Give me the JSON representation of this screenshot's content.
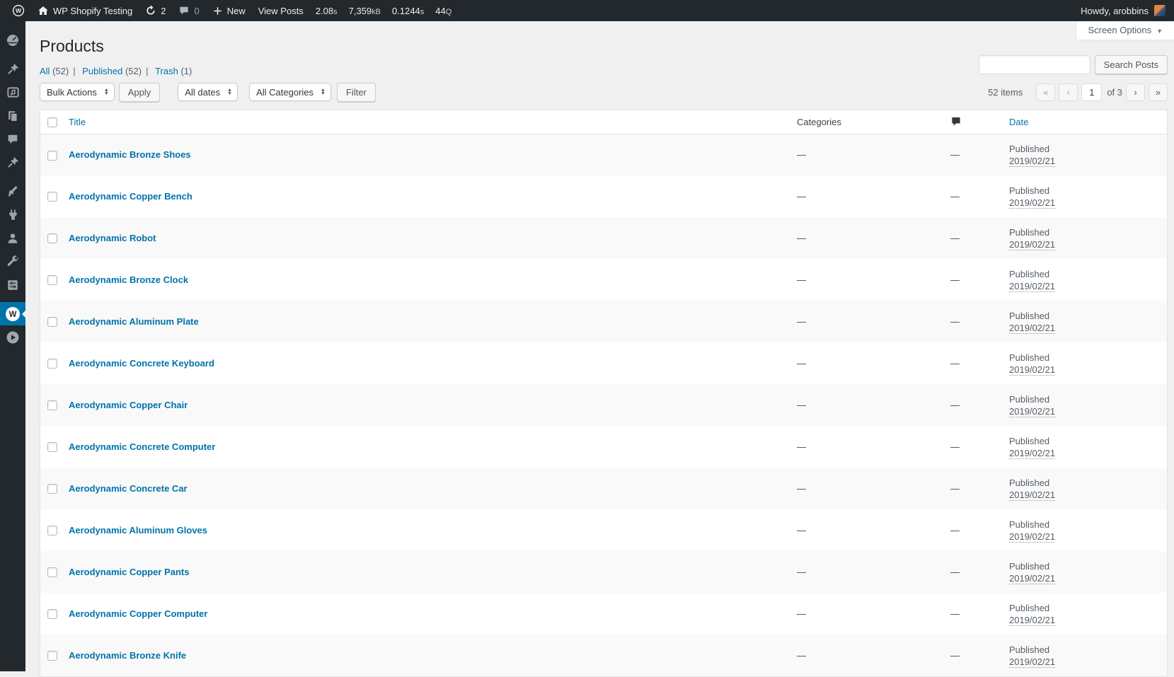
{
  "admin_bar": {
    "site_name": "WP Shopify Testing",
    "update_count": "2",
    "comment_count": "0",
    "new_label": "New",
    "view_posts_label": "View Posts",
    "stats": [
      {
        "v": "2.08",
        "u": "s"
      },
      {
        "v": "7,359",
        "u": "kB"
      },
      {
        "v": "0.1244",
        "u": "s"
      },
      {
        "v": "44",
        "u": "Q"
      }
    ],
    "howdy": "Howdy, arobbins",
    "bg_color": "#23282d"
  },
  "screen_options": {
    "label": "Screen Options",
    "caret": "▼"
  },
  "sidebar": {
    "active_item": "wp-shopify",
    "icons": [
      "dashboard-icon",
      "posts-pin-icon",
      "media-icon",
      "pages-icon",
      "comments-icon",
      "products-pin-icon",
      "appearance-brush-icon",
      "plugins-plug-icon",
      "users-icon",
      "tools-wrench-icon",
      "settings-icon",
      "wp-shopify-icon",
      "play-circle-icon"
    ],
    "active_color": "#0073aa"
  },
  "page": {
    "title": "Products",
    "filters": [
      {
        "label": "All",
        "count": "(52)"
      },
      {
        "label": "Published",
        "count": "(52)"
      },
      {
        "label": "Trash",
        "count": "(1)"
      }
    ],
    "filter_separator": "|",
    "search": {
      "value": "",
      "button_label": "Search Posts"
    },
    "toolbar": {
      "bulk_actions": "Bulk Actions",
      "apply": "Apply",
      "all_dates": "All dates",
      "all_categories": "All Categories",
      "filter": "Filter"
    },
    "pagination": {
      "items_count": "52 items",
      "first": "«",
      "prev": "‹",
      "current_page": "1",
      "of": "of 3",
      "next": "›",
      "last": "»"
    },
    "accent_color": "#0073aa"
  },
  "table": {
    "headers": {
      "title": "Title",
      "categories": "Categories",
      "comments_icon": "comment-bubble-icon",
      "date": "Date"
    },
    "rows": [
      {
        "title": "Aerodynamic Bronze Shoes",
        "categories": "—",
        "comments": "—",
        "status": "Published",
        "date": "2019/02/21"
      },
      {
        "title": "Aerodynamic Copper Bench",
        "categories": "—",
        "comments": "—",
        "status": "Published",
        "date": "2019/02/21"
      },
      {
        "title": "Aerodynamic Robot",
        "categories": "—",
        "comments": "—",
        "status": "Published",
        "date": "2019/02/21"
      },
      {
        "title": "Aerodynamic Bronze Clock",
        "categories": "—",
        "comments": "—",
        "status": "Published",
        "date": "2019/02/21"
      },
      {
        "title": "Aerodynamic Aluminum Plate",
        "categories": "—",
        "comments": "—",
        "status": "Published",
        "date": "2019/02/21"
      },
      {
        "title": "Aerodynamic Concrete Keyboard",
        "categories": "—",
        "comments": "—",
        "status": "Published",
        "date": "2019/02/21"
      },
      {
        "title": "Aerodynamic Copper Chair",
        "categories": "—",
        "comments": "—",
        "status": "Published",
        "date": "2019/02/21"
      },
      {
        "title": "Aerodynamic Concrete Computer",
        "categories": "—",
        "comments": "—",
        "status": "Published",
        "date": "2019/02/21"
      },
      {
        "title": "Aerodynamic Concrete Car",
        "categories": "—",
        "comments": "—",
        "status": "Published",
        "date": "2019/02/21"
      },
      {
        "title": "Aerodynamic Aluminum Gloves",
        "categories": "—",
        "comments": "—",
        "status": "Published",
        "date": "2019/02/21"
      },
      {
        "title": "Aerodynamic Copper Pants",
        "categories": "—",
        "comments": "—",
        "status": "Published",
        "date": "2019/02/21"
      },
      {
        "title": "Aerodynamic Copper Computer",
        "categories": "—",
        "comments": "—",
        "status": "Published",
        "date": "2019/02/21"
      },
      {
        "title": "Aerodynamic Bronze Knife",
        "categories": "—",
        "comments": "—",
        "status": "Published",
        "date": "2019/02/21"
      }
    ]
  }
}
